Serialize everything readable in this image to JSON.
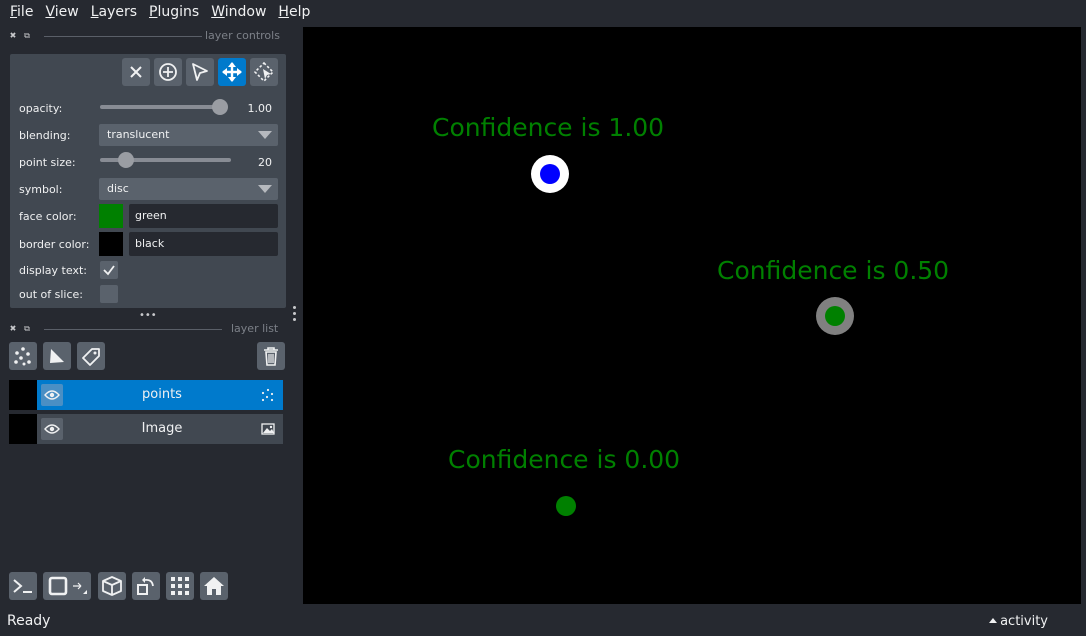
{
  "menu": {
    "items": [
      {
        "key": "F",
        "rest": "ile"
      },
      {
        "key": "V",
        "rest": "iew"
      },
      {
        "key": "L",
        "rest": "ayers"
      },
      {
        "key": "P",
        "rest": "lugins"
      },
      {
        "key": "W",
        "rest": "indow"
      },
      {
        "key": "H",
        "rest": "elp"
      }
    ]
  },
  "layer_controls": {
    "title": "layer controls",
    "opacity_label": "opacity:",
    "opacity_value": "1.00",
    "opacity_fraction": 1.0,
    "blending_label": "blending:",
    "blending_value": "translucent",
    "point_size_label": "point size:",
    "point_size_value": "20",
    "point_size_fraction": 0.2,
    "symbol_label": "symbol:",
    "symbol_value": "disc",
    "face_color_label": "face color:",
    "face_color_value": "green",
    "face_color_hex": "#008000",
    "border_color_label": "border color:",
    "border_color_value": "black",
    "border_color_hex": "#000000",
    "display_text_label": "display text:",
    "display_text_checked": true,
    "out_of_slice_label": "out of slice:",
    "out_of_slice_checked": false
  },
  "layer_list": {
    "title": "layer list",
    "layers": [
      {
        "name": "points",
        "type": "points",
        "selected": true
      },
      {
        "name": "Image",
        "type": "image",
        "selected": false
      }
    ]
  },
  "canvas": {
    "labels": [
      "Confidence is 1.00",
      "Confidence is 0.50",
      "Confidence is 0.00"
    ],
    "text_color": "#008000"
  },
  "status": {
    "text": "Ready",
    "activity": "activity"
  },
  "colors": {
    "background": "#262930",
    "panel": "#414851",
    "accent": "#007acc"
  }
}
